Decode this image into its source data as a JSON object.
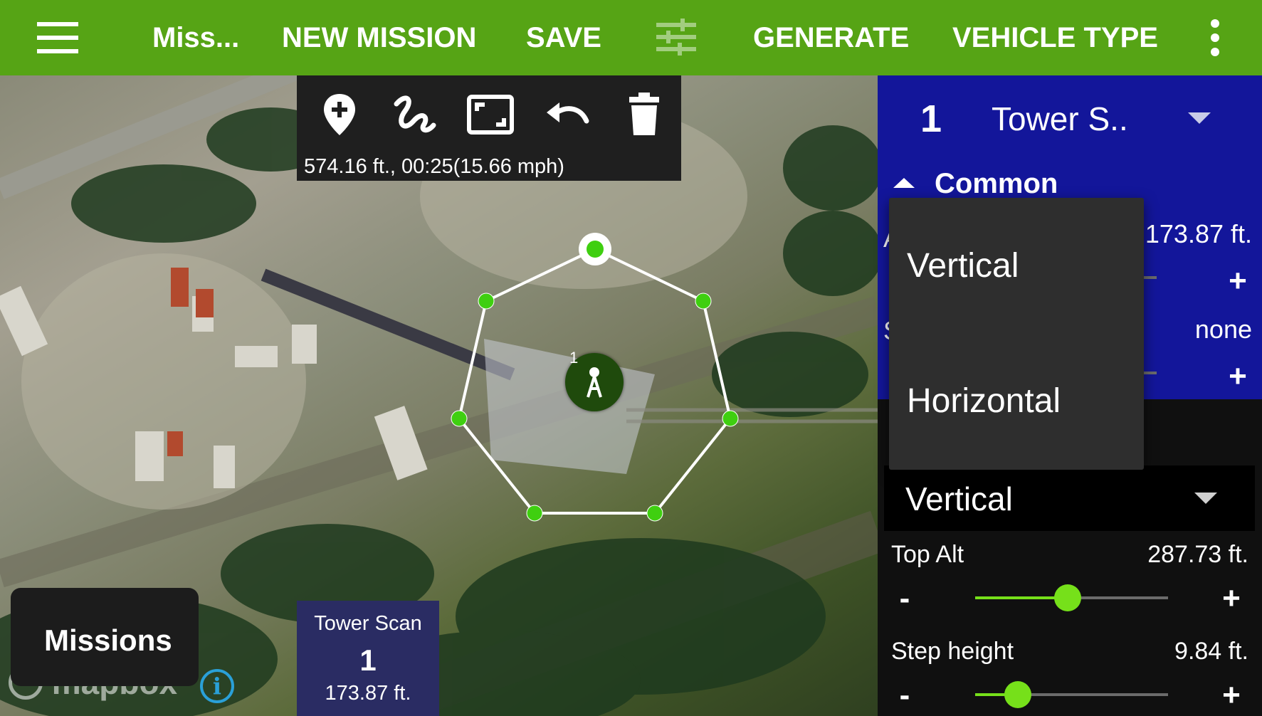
{
  "appbar": {
    "mission_name": "Miss...",
    "new_mission": "NEW MISSION",
    "save": "SAVE",
    "generate": "GENERATE",
    "vehicle_type": "VEHICLE TYPE",
    "icons": [
      "hamburger-menu-icon",
      "sliders-icon",
      "more-vert-icon"
    ]
  },
  "draw_toolbar": {
    "tools": [
      "add-waypoint-icon",
      "draw-path-icon",
      "fit-bounds-icon",
      "undo-icon",
      "delete-icon"
    ],
    "stats": "574.16 ft., 00:25(15.66 mph)"
  },
  "map": {
    "provider_logo": "mapbox",
    "info_icon": "info-icon",
    "waypoint_number": "1",
    "tower_icon": "tower-icon"
  },
  "missions_button": {
    "label": "Missions"
  },
  "mission_card": {
    "title": "Tower Scan",
    "number": "1",
    "altitude": "173.87 ft."
  },
  "panel": {
    "item_number": "1",
    "item_name": "Tower S..",
    "common_section": "Common",
    "partial_label_1": "A",
    "altitude_value": "173.87 ft.",
    "partial_label_2": "S",
    "speed_value": "none",
    "scan_direction": "Vertical",
    "top_alt": {
      "label": "Top Alt",
      "value": "287.73 ft.",
      "minus": "-",
      "plus": "+",
      "level": 0.48
    },
    "step_height": {
      "label": "Step height",
      "value": "9.84 ft.",
      "minus": "-",
      "plus": "+",
      "level": 0.22
    },
    "plus": "+",
    "accent_color": "#76e01a",
    "header_color": "#13169a"
  },
  "dropdown": {
    "options": [
      "Vertical",
      "Horizontal"
    ]
  }
}
